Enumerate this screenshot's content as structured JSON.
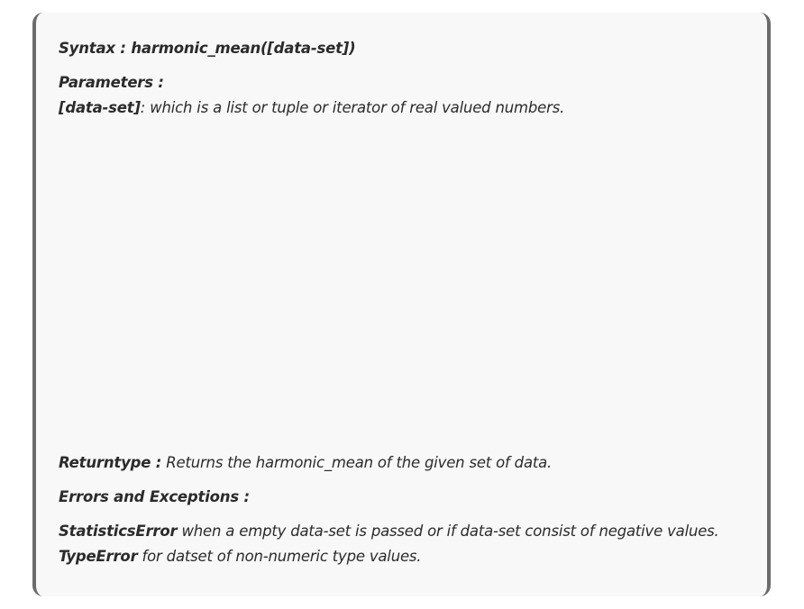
{
  "syntax": {
    "label": "Syntax :",
    "signature": "harmonic_mean([data-set])"
  },
  "parameters": {
    "heading": "Parameters :",
    "name": "[data-set]",
    "description": ": which is a list or tuple or iterator of real valued numbers."
  },
  "returntype": {
    "label": "Returntype :",
    "description": "Returns the harmonic_mean of the given set of data."
  },
  "errors": {
    "heading": "Errors and Exceptions :",
    "items": [
      {
        "name": "StatisticsError",
        "description": "when a empty data-set is passed or if data-set consist of negative values."
      },
      {
        "name": "TypeError",
        "description": "for datset of non-numeric type values."
      }
    ]
  }
}
